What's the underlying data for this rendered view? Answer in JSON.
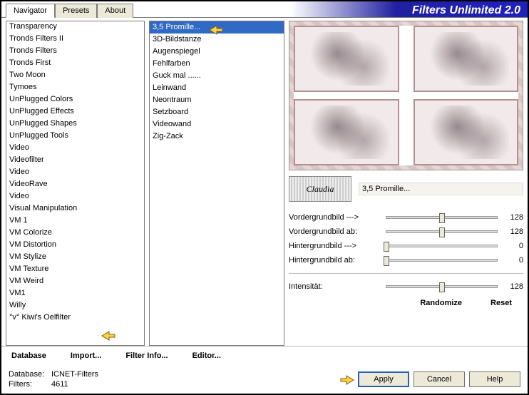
{
  "title": "Filters Unlimited 2.0",
  "tabs": [
    "Navigator",
    "Presets",
    "About"
  ],
  "activeTab": 0,
  "categories": [
    "Transparency",
    "Tronds Filters II",
    "Tronds Filters",
    "Tronds First",
    "Two Moon",
    "Tymoes",
    "UnPlugged Colors",
    "UnPlugged Effects",
    "UnPlugged Shapes",
    "UnPlugged Tools",
    "Video",
    "Videofilter",
    "Video",
    "VideoRave",
    "Video",
    "Visual Manipulation",
    "VM 1",
    "VM Colorize",
    "VM Distortion",
    "VM Stylize",
    "VM Texture",
    "VM Weird",
    "VM1",
    "Willy",
    "°v° Kiwi's Oelfilter"
  ],
  "selectedCategoryIndex": 24,
  "filters": [
    "3,5 Promille...",
    "3D-Bildstanze",
    "Augenspiegel",
    "Fehlfarben",
    "Guck mal ......",
    "Leinwand",
    "Neontraum",
    "Setzboard",
    "Videowand",
    "Zig-Zack"
  ],
  "selectedFilterIndex": 0,
  "currentFilterName": "3,5 Promille...",
  "logoText": "Claudia",
  "params": [
    {
      "label": "Vordergrundbild --->",
      "value": 128,
      "pct": 50
    },
    {
      "label": "Vordergrundbild ab:",
      "value": 128,
      "pct": 50
    },
    {
      "label": "Hintergrundbild --->",
      "value": 0,
      "pct": 0
    },
    {
      "label": "Hintergrundbild ab:",
      "value": 0,
      "pct": 0
    }
  ],
  "intensity": {
    "label": "Intensität:",
    "value": 128,
    "pct": 50
  },
  "toolbar": {
    "database": "Database",
    "import": "Import...",
    "filterInfo": "Filter Info...",
    "editor": "Editor...",
    "randomize": "Randomize",
    "reset": "Reset"
  },
  "status": {
    "dbLabel": "Database:",
    "dbValue": "ICNET-Filters",
    "filtersLabel": "Filters:",
    "filtersValue": "4611"
  },
  "buttons": {
    "apply": "Apply",
    "cancel": "Cancel",
    "help": "Help"
  }
}
